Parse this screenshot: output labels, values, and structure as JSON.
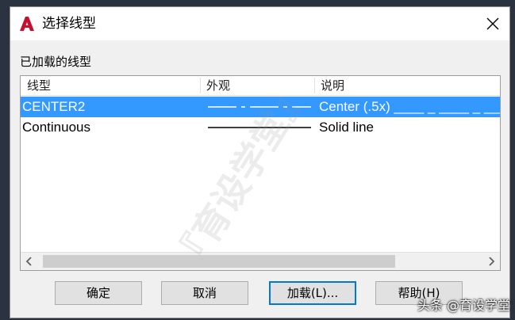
{
  "window": {
    "title": "选择线型",
    "icon": "autocad-icon",
    "close_icon": "close-icon"
  },
  "group": {
    "label": "已加载的线型"
  },
  "table": {
    "columns": [
      "线型",
      "外观",
      "说明"
    ],
    "rows": [
      {
        "linetype": "CENTER2",
        "appearance": "center-dash",
        "description": "Center (.5x) ____ _ ____ _ ____ _",
        "selected": true
      },
      {
        "linetype": "Continuous",
        "appearance": "solid",
        "description": "Solid line",
        "selected": false
      }
    ]
  },
  "buttons": {
    "ok": "确定",
    "cancel": "取消",
    "load": "加载(L)...",
    "help": "帮助(H)"
  },
  "watermarks": {
    "diagonal": "『育设学堂』",
    "corner": "头条 @育设学堂"
  },
  "colors": {
    "selection": "#3399ff",
    "brand_red": "#c8102e"
  }
}
